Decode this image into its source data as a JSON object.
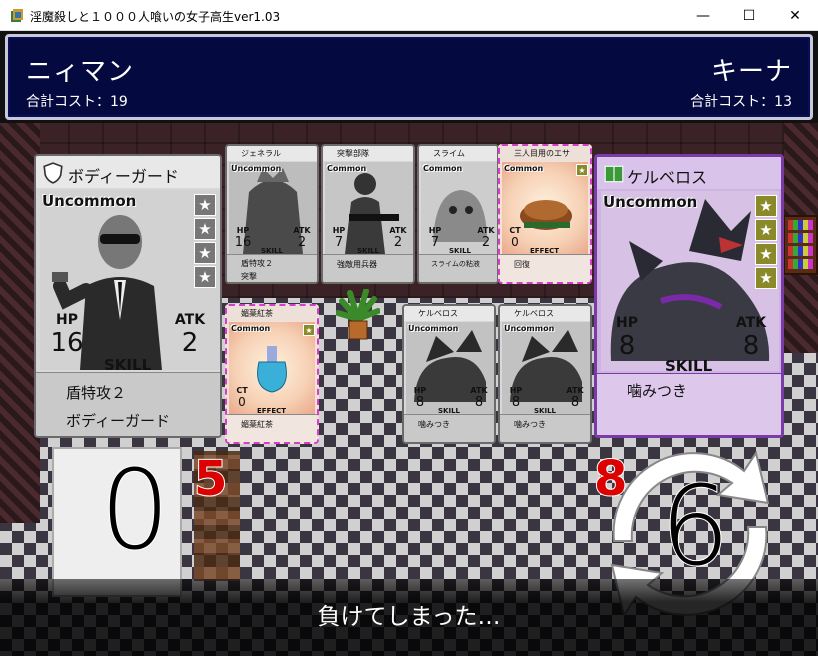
{
  "window": {
    "title": "淫魔殺しと１０００人喰いの女子高生ver1.03",
    "minimize": "—",
    "maximize": "☐",
    "close": "✕"
  },
  "players": {
    "left": {
      "name": "ニィマン",
      "cost_label": "合計コスト：",
      "cost": "19"
    },
    "right": {
      "name": "キーナ",
      "cost_label": "合計コスト：",
      "cost": "13"
    }
  },
  "cards": {
    "bodyguard": {
      "title": "ボディーガード",
      "rarity": "Uncommon",
      "hp_label": "HP",
      "hp": "16",
      "atk_label": "ATK",
      "atk": "2",
      "skill_label": "SKILL",
      "skill1": "盾特攻２",
      "skill2": "ボディーガード",
      "stars": 4
    },
    "general": {
      "title": "ジェネラル",
      "rarity": "Uncommon",
      "hp_label": "HP",
      "hp": "16",
      "atk_label": "ATK",
      "atk": "2",
      "skill_label": "SKILL",
      "skill1": "盾特攻２",
      "skill2": "突撃"
    },
    "assault": {
      "title": "突撃部隊",
      "rarity": "Common",
      "hp_label": "HP",
      "hp": "7",
      "atk_label": "ATK",
      "atk": "2",
      "skill_label": "SKILL",
      "skill1": "強敵用兵器"
    },
    "slime": {
      "title": "スライム",
      "rarity": "Common",
      "hp_label": "HP",
      "hp": "7",
      "atk_label": "ATK",
      "atk": "2",
      "skill_label": "SKILL",
      "skill1": "スライムの粘液"
    },
    "bait": {
      "title": "三人目用のエサ",
      "rarity": "Common",
      "ct_label": "CT",
      "ct": "0",
      "effect_label": "EFFECT",
      "effect": "回復"
    },
    "tea": {
      "title": "媚薬紅茶",
      "rarity": "Common",
      "ct_label": "CT",
      "ct": "0",
      "effect_label": "EFFECT",
      "effect": "媚薬紅茶"
    },
    "cerberus_a": {
      "title": "ケルベロス",
      "rarity": "Uncommon",
      "hp_label": "HP",
      "hp": "8",
      "atk_label": "ATK",
      "atk": "8",
      "skill_label": "SKILL",
      "skill1": "噛みつき"
    },
    "cerberus_b": {
      "title": "ケルベロス",
      "rarity": "Uncommon",
      "hp_label": "HP",
      "hp": "8",
      "atk_label": "ATK",
      "atk": "8",
      "skill_label": "SKILL",
      "skill1": "噛みつき"
    },
    "cerberus_main": {
      "title": "ケルベロス",
      "rarity": "Uncommon",
      "hp_label": "HP",
      "hp": "8",
      "atk_label": "ATK",
      "atk": "8",
      "skill_label": "SKILL",
      "skill1": "噛みつき",
      "stars": 4
    }
  },
  "scores": {
    "left_big": "0",
    "left_small": "5",
    "right_small": "8",
    "right_big": "6"
  },
  "message": "負けてしまった…",
  "colors": {
    "header_bg": "#040a40",
    "enemy_card": "#cdb4e0",
    "red_number": "#dd0000"
  }
}
